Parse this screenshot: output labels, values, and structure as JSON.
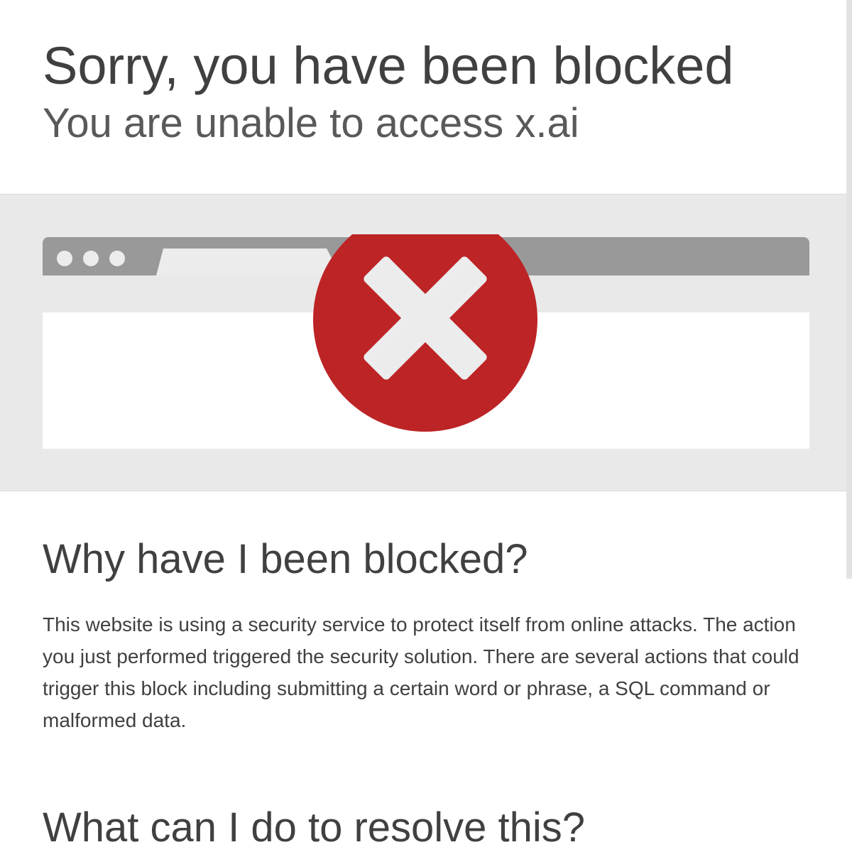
{
  "header": {
    "title": "Sorry, you have been blocked",
    "subtitle": "You are unable to access x.ai"
  },
  "illustration": {
    "icon": "error-x-icon",
    "circle_color": "#bd2426",
    "bar_color": "#999999"
  },
  "why": {
    "heading": "Why have I been blocked?",
    "body": "This website is using a security service to protect itself from online attacks. The action you just performed triggered the security solution. There are several actions that could trigger this block including submitting a certain word or phrase, a SQL command or malformed data."
  },
  "resolve": {
    "heading": "What can I do to resolve this?"
  }
}
